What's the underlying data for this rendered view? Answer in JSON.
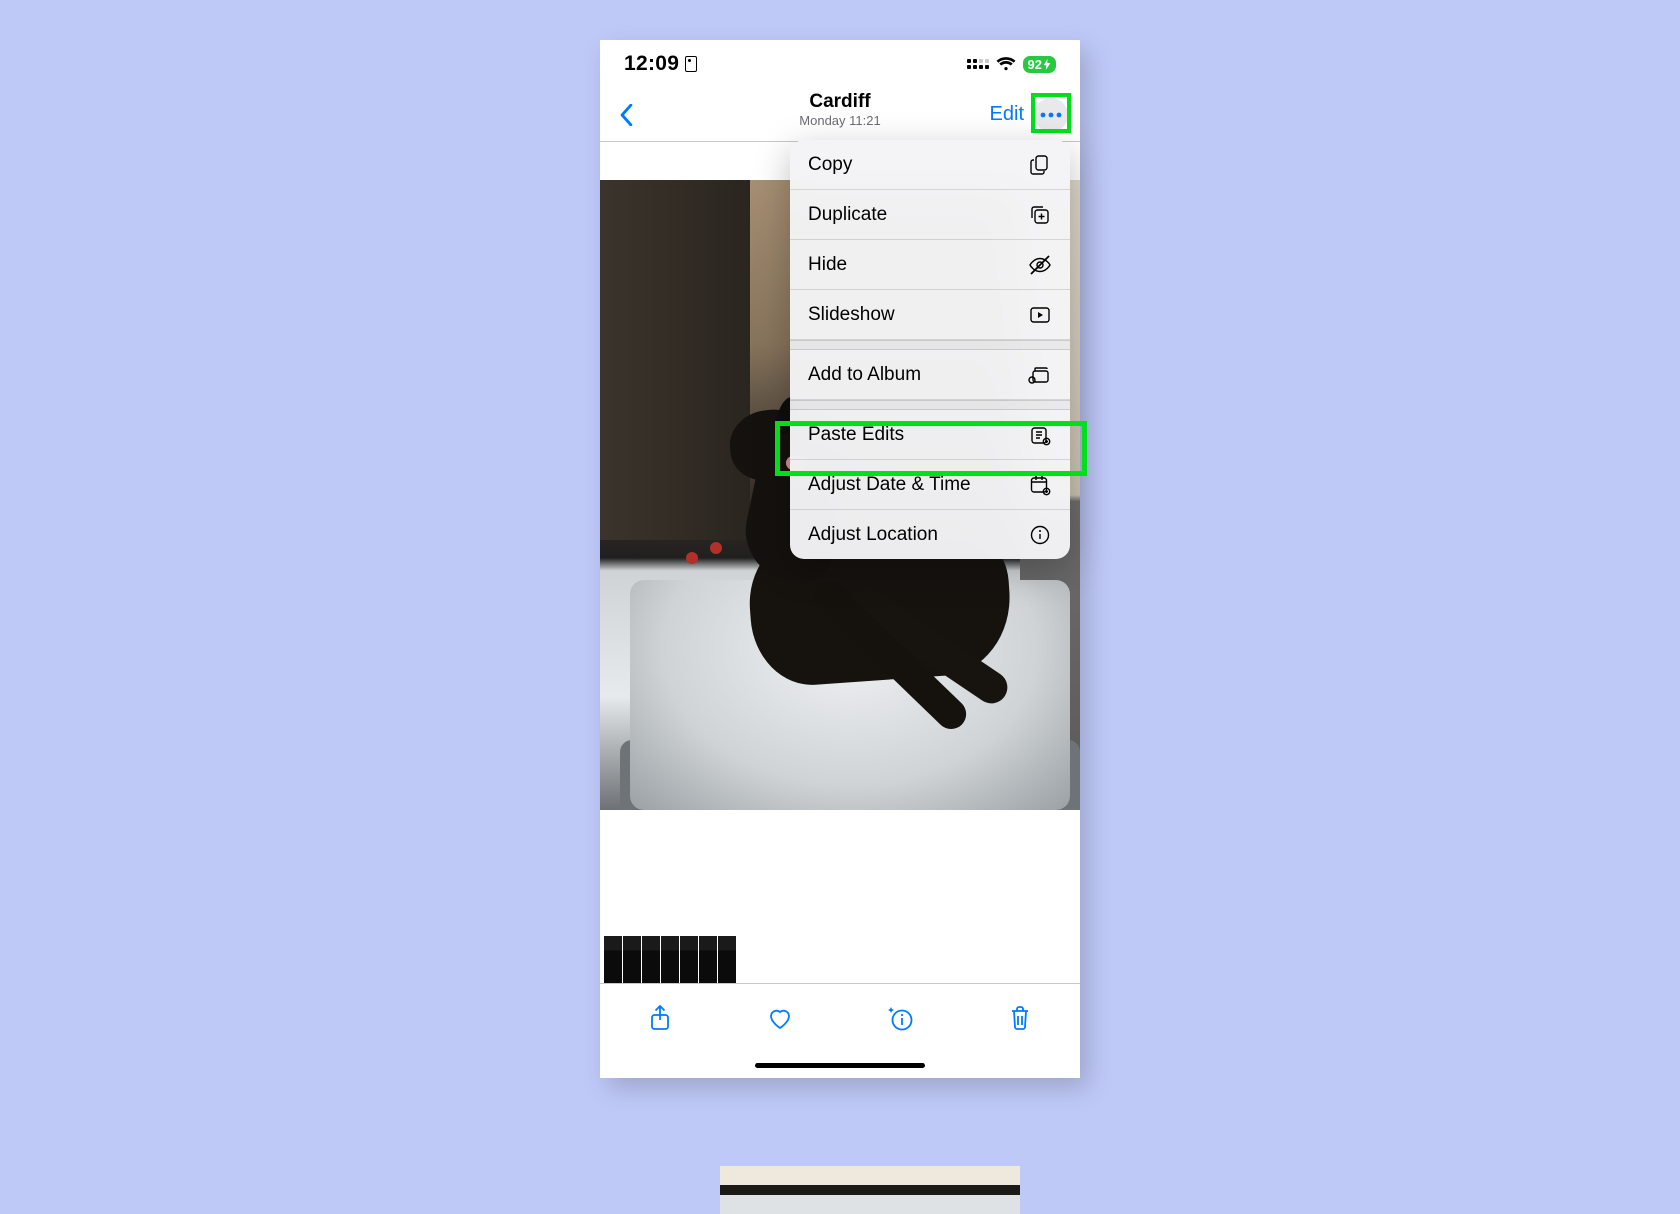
{
  "status": {
    "time": "12:09",
    "battery": "92"
  },
  "nav": {
    "title": "Cardiff",
    "subtitle": "Monday  11:21",
    "edit_label": "Edit"
  },
  "menu": {
    "copy": "Copy",
    "duplicate": "Duplicate",
    "hide": "Hide",
    "slideshow": "Slideshow",
    "add_album": "Add to Album",
    "paste_edits": "Paste Edits",
    "adjust_date": "Adjust Date & Time",
    "adjust_location": "Adjust Location"
  },
  "highlight": {
    "more_button": true,
    "paste_edits_row": true
  }
}
